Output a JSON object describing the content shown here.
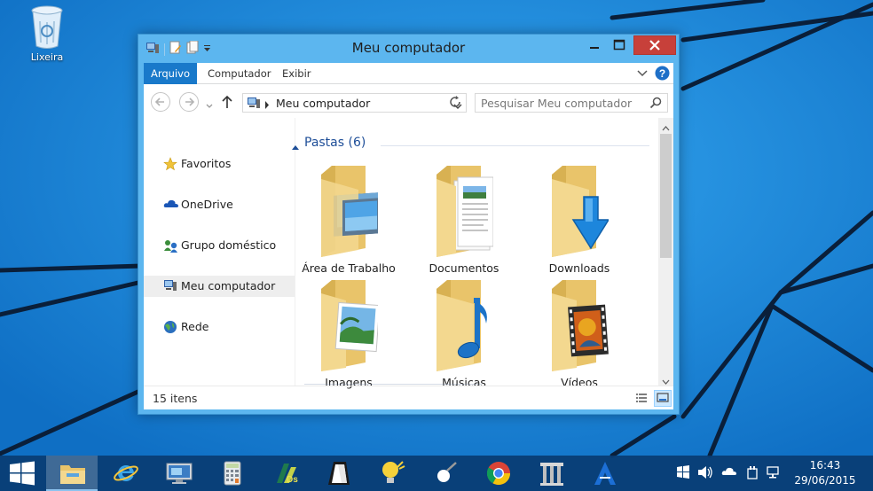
{
  "desktop": {
    "icons": [
      {
        "label": "Lixeira",
        "icon": "recycle-bin-icon"
      }
    ]
  },
  "window": {
    "title": "Meu computador",
    "ribbon_tabs": [
      "Arquivo",
      "Computador",
      "Exibir"
    ],
    "address": {
      "path": "Meu computador"
    },
    "search": {
      "placeholder": "Pesquisar Meu computador"
    },
    "nav": [
      {
        "label": "Favoritos",
        "icon": "star-icon"
      },
      {
        "label": "OneDrive",
        "icon": "onedrive-icon"
      },
      {
        "label": "Grupo doméstico",
        "icon": "homegroup-icon"
      },
      {
        "label": "Meu computador",
        "icon": "computer-icon",
        "selected": true
      },
      {
        "label": "Rede",
        "icon": "network-icon"
      }
    ],
    "group": {
      "title": "Pastas (6)"
    },
    "folders": [
      {
        "label": "Área de Trabalho",
        "overlay": "desktop"
      },
      {
        "label": "Documentos",
        "overlay": "documents"
      },
      {
        "label": "Downloads",
        "overlay": "downloads"
      },
      {
        "label": "Imagens",
        "overlay": "pictures"
      },
      {
        "label": "Músicas",
        "overlay": "music"
      },
      {
        "label": "Vídeos",
        "overlay": "videos"
      }
    ],
    "status": "15 itens"
  },
  "taskbar": {
    "items": [
      "start",
      "file-explorer",
      "internet-explorer",
      "remote-desktop",
      "calculator",
      "dreamweaver",
      "inkscape",
      "lightbulb-app",
      "paint-app",
      "chrome",
      "pantheon-app",
      "autocad"
    ],
    "clock": {
      "time": "16:43",
      "date": "29/06/2015"
    }
  },
  "colors": {
    "desktop": "#1c86d8",
    "titlebar": "#5cb6ef",
    "close": "#c7403a",
    "file_tab": "#1979ca",
    "link": "#1e4e98",
    "taskbar": "#093c72"
  }
}
